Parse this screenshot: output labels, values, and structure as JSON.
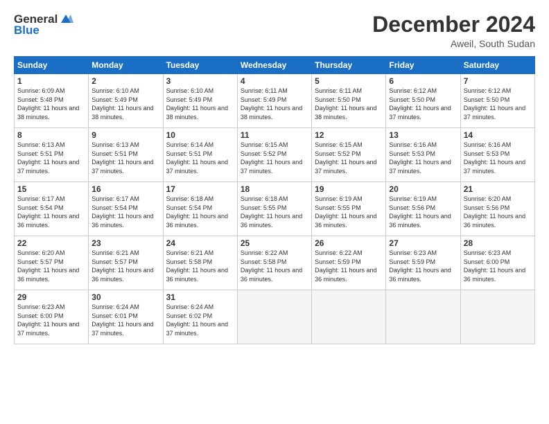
{
  "logo": {
    "general": "General",
    "blue": "Blue"
  },
  "title": "December 2024",
  "subtitle": "Aweil, South Sudan",
  "days_header": [
    "Sunday",
    "Monday",
    "Tuesday",
    "Wednesday",
    "Thursday",
    "Friday",
    "Saturday"
  ],
  "weeks": [
    [
      {
        "day": "1",
        "sunrise": "6:09 AM",
        "sunset": "5:48 PM",
        "daylight": "11 hours and 38 minutes."
      },
      {
        "day": "2",
        "sunrise": "6:10 AM",
        "sunset": "5:49 PM",
        "daylight": "11 hours and 38 minutes."
      },
      {
        "day": "3",
        "sunrise": "6:10 AM",
        "sunset": "5:49 PM",
        "daylight": "11 hours and 38 minutes."
      },
      {
        "day": "4",
        "sunrise": "6:11 AM",
        "sunset": "5:49 PM",
        "daylight": "11 hours and 38 minutes."
      },
      {
        "day": "5",
        "sunrise": "6:11 AM",
        "sunset": "5:50 PM",
        "daylight": "11 hours and 38 minutes."
      },
      {
        "day": "6",
        "sunrise": "6:12 AM",
        "sunset": "5:50 PM",
        "daylight": "11 hours and 37 minutes."
      },
      {
        "day": "7",
        "sunrise": "6:12 AM",
        "sunset": "5:50 PM",
        "daylight": "11 hours and 37 minutes."
      }
    ],
    [
      {
        "day": "8",
        "sunrise": "6:13 AM",
        "sunset": "5:51 PM",
        "daylight": "11 hours and 37 minutes."
      },
      {
        "day": "9",
        "sunrise": "6:13 AM",
        "sunset": "5:51 PM",
        "daylight": "11 hours and 37 minutes."
      },
      {
        "day": "10",
        "sunrise": "6:14 AM",
        "sunset": "5:51 PM",
        "daylight": "11 hours and 37 minutes."
      },
      {
        "day": "11",
        "sunrise": "6:15 AM",
        "sunset": "5:52 PM",
        "daylight": "11 hours and 37 minutes."
      },
      {
        "day": "12",
        "sunrise": "6:15 AM",
        "sunset": "5:52 PM",
        "daylight": "11 hours and 37 minutes."
      },
      {
        "day": "13",
        "sunrise": "6:16 AM",
        "sunset": "5:53 PM",
        "daylight": "11 hours and 37 minutes."
      },
      {
        "day": "14",
        "sunrise": "6:16 AM",
        "sunset": "5:53 PM",
        "daylight": "11 hours and 37 minutes."
      }
    ],
    [
      {
        "day": "15",
        "sunrise": "6:17 AM",
        "sunset": "5:54 PM",
        "daylight": "11 hours and 36 minutes."
      },
      {
        "day": "16",
        "sunrise": "6:17 AM",
        "sunset": "5:54 PM",
        "daylight": "11 hours and 36 minutes."
      },
      {
        "day": "17",
        "sunrise": "6:18 AM",
        "sunset": "5:54 PM",
        "daylight": "11 hours and 36 minutes."
      },
      {
        "day": "18",
        "sunrise": "6:18 AM",
        "sunset": "5:55 PM",
        "daylight": "11 hours and 36 minutes."
      },
      {
        "day": "19",
        "sunrise": "6:19 AM",
        "sunset": "5:55 PM",
        "daylight": "11 hours and 36 minutes."
      },
      {
        "day": "20",
        "sunrise": "6:19 AM",
        "sunset": "5:56 PM",
        "daylight": "11 hours and 36 minutes."
      },
      {
        "day": "21",
        "sunrise": "6:20 AM",
        "sunset": "5:56 PM",
        "daylight": "11 hours and 36 minutes."
      }
    ],
    [
      {
        "day": "22",
        "sunrise": "6:20 AM",
        "sunset": "5:57 PM",
        "daylight": "11 hours and 36 minutes."
      },
      {
        "day": "23",
        "sunrise": "6:21 AM",
        "sunset": "5:57 PM",
        "daylight": "11 hours and 36 minutes."
      },
      {
        "day": "24",
        "sunrise": "6:21 AM",
        "sunset": "5:58 PM",
        "daylight": "11 hours and 36 minutes."
      },
      {
        "day": "25",
        "sunrise": "6:22 AM",
        "sunset": "5:58 PM",
        "daylight": "11 hours and 36 minutes."
      },
      {
        "day": "26",
        "sunrise": "6:22 AM",
        "sunset": "5:59 PM",
        "daylight": "11 hours and 36 minutes."
      },
      {
        "day": "27",
        "sunrise": "6:23 AM",
        "sunset": "5:59 PM",
        "daylight": "11 hours and 36 minutes."
      },
      {
        "day": "28",
        "sunrise": "6:23 AM",
        "sunset": "6:00 PM",
        "daylight": "11 hours and 36 minutes."
      }
    ],
    [
      {
        "day": "29",
        "sunrise": "6:23 AM",
        "sunset": "6:00 PM",
        "daylight": "11 hours and 37 minutes."
      },
      {
        "day": "30",
        "sunrise": "6:24 AM",
        "sunset": "6:01 PM",
        "daylight": "11 hours and 37 minutes."
      },
      {
        "day": "31",
        "sunrise": "6:24 AM",
        "sunset": "6:02 PM",
        "daylight": "11 hours and 37 minutes."
      },
      null,
      null,
      null,
      null
    ]
  ]
}
